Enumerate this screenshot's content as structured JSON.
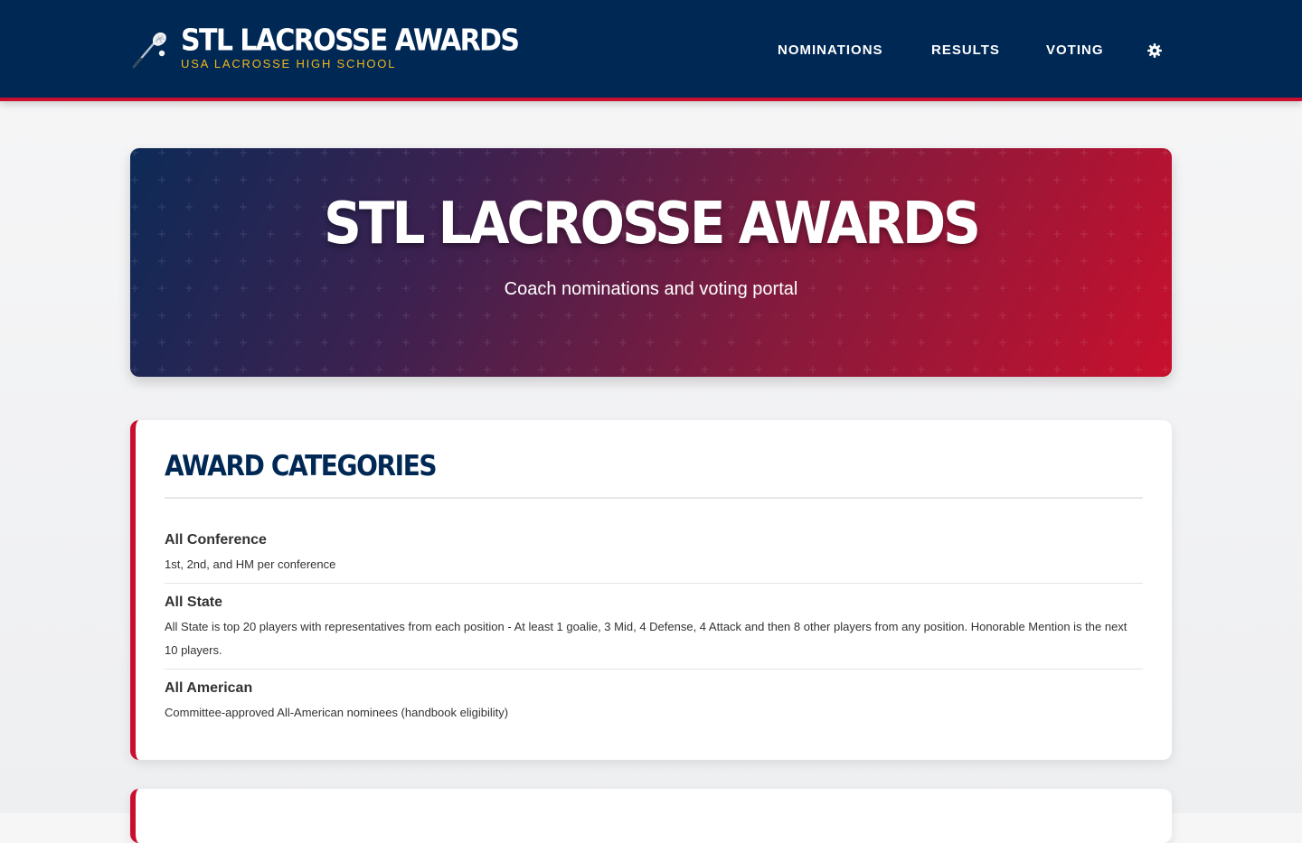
{
  "navbar": {
    "brand_title": "STL LACROSSE AWARDS",
    "brand_subtitle": "USA LACROSSE HIGH SCHOOL",
    "brand_icon": "lacrosse-stick-icon",
    "links": [
      {
        "label": "NOMINATIONS"
      },
      {
        "label": "RESULTS"
      },
      {
        "label": "VOTING"
      }
    ],
    "settings_icon": "gear-icon"
  },
  "hero": {
    "title": "STL LACROSSE AWARDS",
    "subtitle": "Coach nominations and voting portal"
  },
  "categories": {
    "title": "AWARD CATEGORIES",
    "items": [
      {
        "name": "All Conference",
        "description": "1st, 2nd, and HM per conference"
      },
      {
        "name": "All State",
        "description": "All State is top 20 players with representatives from each position - At least 1 goalie, 3 Mid, 4 Defense, 4 Attack and then 8 other players from any position. Honorable Mention is the next 10 players."
      },
      {
        "name": "All American",
        "description": "Committee-approved All-American nominees (handbook eligibility)"
      }
    ]
  },
  "colors": {
    "navy": "#002855",
    "red": "#c8102e",
    "gold": "#f2b81c"
  }
}
